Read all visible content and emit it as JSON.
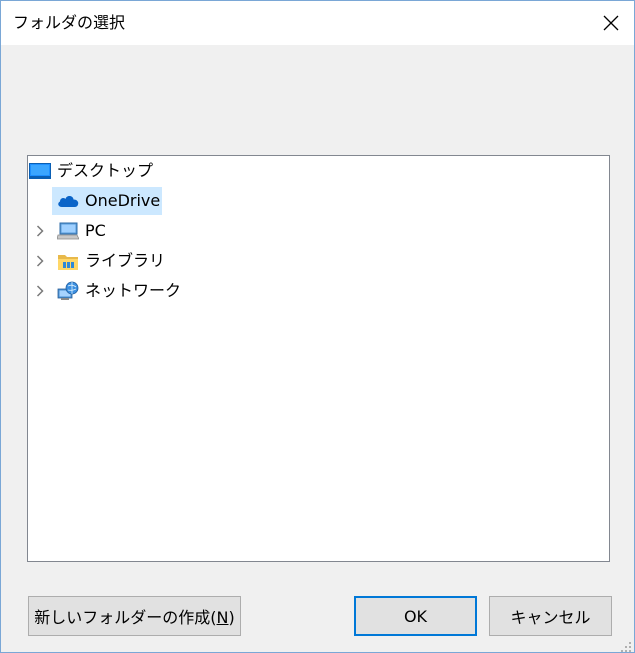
{
  "dialog": {
    "title": "フォルダの選択"
  },
  "tree": {
    "items": [
      {
        "label": "デスクトップ",
        "icon": "desktop-icon",
        "expandable": false,
        "selected": false
      },
      {
        "label": "OneDrive",
        "icon": "onedrive-cloud-icon",
        "expandable": false,
        "selected": true
      },
      {
        "label": "PC",
        "icon": "computer-icon",
        "expandable": true,
        "selected": false
      },
      {
        "label": "ライブラリ",
        "icon": "library-folder-icon",
        "expandable": true,
        "selected": false
      },
      {
        "label": "ネットワーク",
        "icon": "network-icon",
        "expandable": true,
        "selected": false
      }
    ]
  },
  "buttons": {
    "new_folder_prefix": "新しいフォルダーの作成(",
    "new_folder_accel": "N",
    "new_folder_suffix": ")",
    "ok": "OK",
    "cancel": "キャンセル"
  },
  "colors": {
    "selection": "#cce8ff",
    "accent": "#0078d7",
    "window_border": "#7aa7d6"
  }
}
